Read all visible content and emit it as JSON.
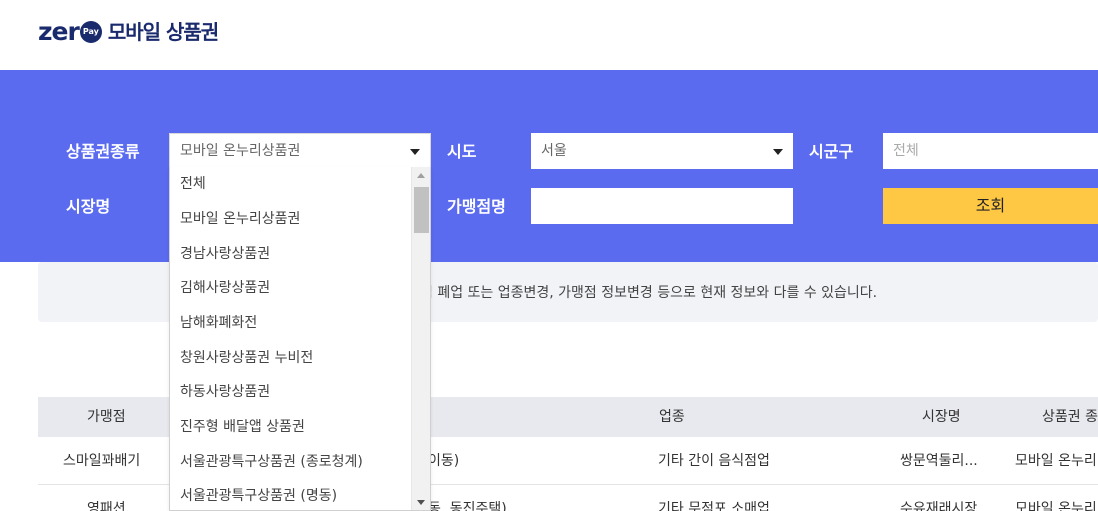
{
  "header": {
    "logo_word": "zer",
    "logo_pay": "Pay",
    "title": "모바일 상품권"
  },
  "search": {
    "voucher_type_label": "상품권종류",
    "voucher_type_value": "모바일 온누리상품권",
    "sido_label": "시도",
    "sido_value": "서울",
    "sigungu_label": "시군구",
    "sigungu_placeholder": "전체",
    "market_label": "시장명",
    "merchant_label": "가맹점명",
    "merchant_value": "",
    "search_button": "조회",
    "accent_color": "#5b6bef",
    "button_color": "#ffc844"
  },
  "notice": {
    "text": "점 폐업 또는 업종변경, 가맹점 정보변경 등으로 현재 정보와 다를 수 있습니다."
  },
  "table": {
    "headers": [
      "가맹점",
      "업종",
      "시장명",
      "상품권 종"
    ],
    "rows": [
      {
        "merchant": "스마일꽈배기",
        "address": "이동)",
        "category": "기타 간이 음식점업",
        "market": "쌍문역둘리...",
        "voucher": "모바일 온누리"
      },
      {
        "merchant": "영패션",
        "address": "동, 동진주택)",
        "category": "기타 무점포 소매업",
        "market": "수유재래시장",
        "voucher": "모바일 온누리"
      }
    ]
  },
  "dropdown": {
    "items": [
      "전체",
      "모바일 온누리상품권",
      "경남사랑상품권",
      "김해사랑상품권",
      "남해화폐화전",
      "창원사랑상품권 누비전",
      "하동사랑상품권",
      "진주형 배달앱 상품권",
      "서울관광특구상품권 (종로청계)",
      "서울관광특구상품권 (명동)"
    ]
  }
}
